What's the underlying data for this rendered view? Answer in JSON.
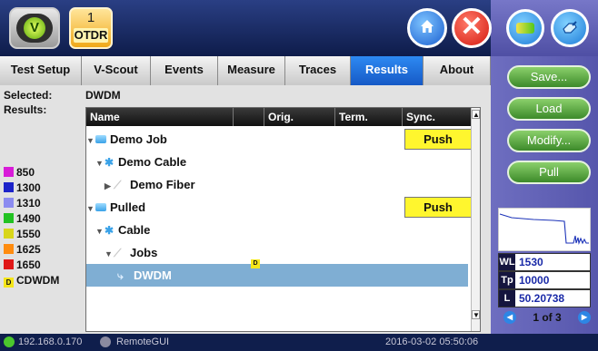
{
  "header": {
    "module_number": "1",
    "module_label": "OTDR"
  },
  "tabs": [
    "Test Setup",
    "V-Scout",
    "Events",
    "Measure",
    "Traces",
    "Results",
    "About"
  ],
  "active_tab": "Results",
  "selection": {
    "selected_label": "Selected:",
    "selected_value": "DWDM",
    "results_label": "Results:"
  },
  "table": {
    "columns": [
      "Name",
      "",
      "Orig.",
      "Term.",
      "Sync."
    ],
    "rows": [
      {
        "name": "Demo Job",
        "sync": "Push"
      },
      {
        "name": "Demo Cable",
        "sync": ""
      },
      {
        "name": "Demo Fiber",
        "sync": ""
      },
      {
        "name": "Pulled",
        "sync": "Push"
      },
      {
        "name": "Cable",
        "sync": ""
      },
      {
        "name": "Jobs",
        "sync": ""
      },
      {
        "name": "DWDM",
        "sync": "",
        "orig_badge": "D"
      }
    ]
  },
  "legend": [
    {
      "label": "850",
      "color": "#d81bd8"
    },
    {
      "label": "1300",
      "color": "#1c23c9"
    },
    {
      "label": "1310",
      "color": "#8b8bf0"
    },
    {
      "label": "1490",
      "color": "#22c222"
    },
    {
      "label": "1550",
      "color": "#d8d61a"
    },
    {
      "label": "1625",
      "color": "#ff8c10"
    },
    {
      "label": "1650",
      "color": "#e01818"
    },
    {
      "label": "CDWDM",
      "badge": "D",
      "color": "#f5e61a"
    }
  ],
  "side_buttons": [
    "Save...",
    "Load",
    "Modify...",
    "Pull"
  ],
  "info": {
    "wl_key": "WL",
    "wl_value": "1530",
    "tp_key": "Tp",
    "tp_value": "10000",
    "l_key": "L",
    "l_value": "50.20738"
  },
  "pager_text": "1 of 3",
  "status": {
    "ip": "192.168.0.170",
    "remote": "RemoteGUI",
    "datetime": "2016-03-02 05:50:06"
  },
  "icons": [
    "v-logo-icon",
    "home-icon",
    "close-icon",
    "battery-icon",
    "ethernet-icon",
    "folder-icon",
    "cable-icon",
    "fiber-icon",
    "scroll-up-icon",
    "scroll-down-icon",
    "prev-page-icon",
    "next-page-icon",
    "network-icon",
    "remote-icon"
  ]
}
